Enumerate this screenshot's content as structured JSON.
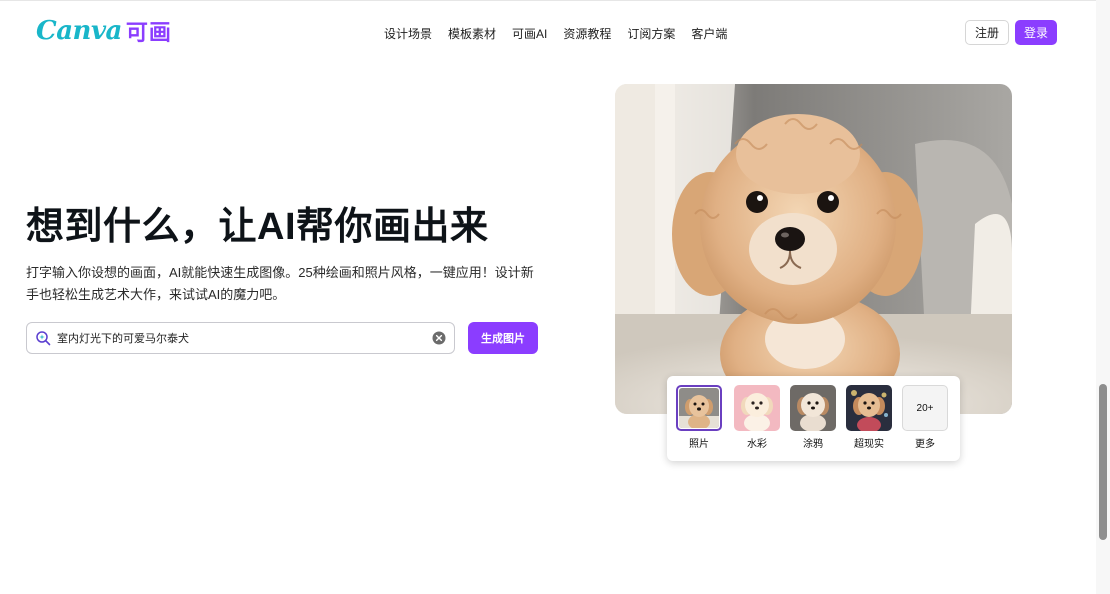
{
  "brand": {
    "logo_text": "Canva可画",
    "accent_color": "#8b3dff"
  },
  "nav": {
    "items": [
      {
        "label": "设计场景"
      },
      {
        "label": "模板素材"
      },
      {
        "label": "可画AI"
      },
      {
        "label": "资源教程"
      },
      {
        "label": "订阅方案"
      },
      {
        "label": "客户端"
      }
    ]
  },
  "auth": {
    "register_label": "注册",
    "login_label": "登录"
  },
  "hero": {
    "title": "想到什么，让AI帮你画出来",
    "description": "打字输入你设想的画面，AI就能快速生成图像。25种绘画和照片风格，一键应用！设计新手也轻松生成艺术大作，来试试AI的魔力吧。"
  },
  "search": {
    "value": "室内灯光下的可爱马尔泰犬",
    "search_icon": "ai-search-icon",
    "clear_icon": "clear-icon",
    "generate_label": "生成图片"
  },
  "styles": {
    "selected": "照片",
    "options": [
      {
        "label": "照片"
      },
      {
        "label": "水彩"
      },
      {
        "label": "涂鸦"
      },
      {
        "label": "超现实"
      }
    ],
    "more": {
      "badge": "20+",
      "label": "更多"
    }
  }
}
